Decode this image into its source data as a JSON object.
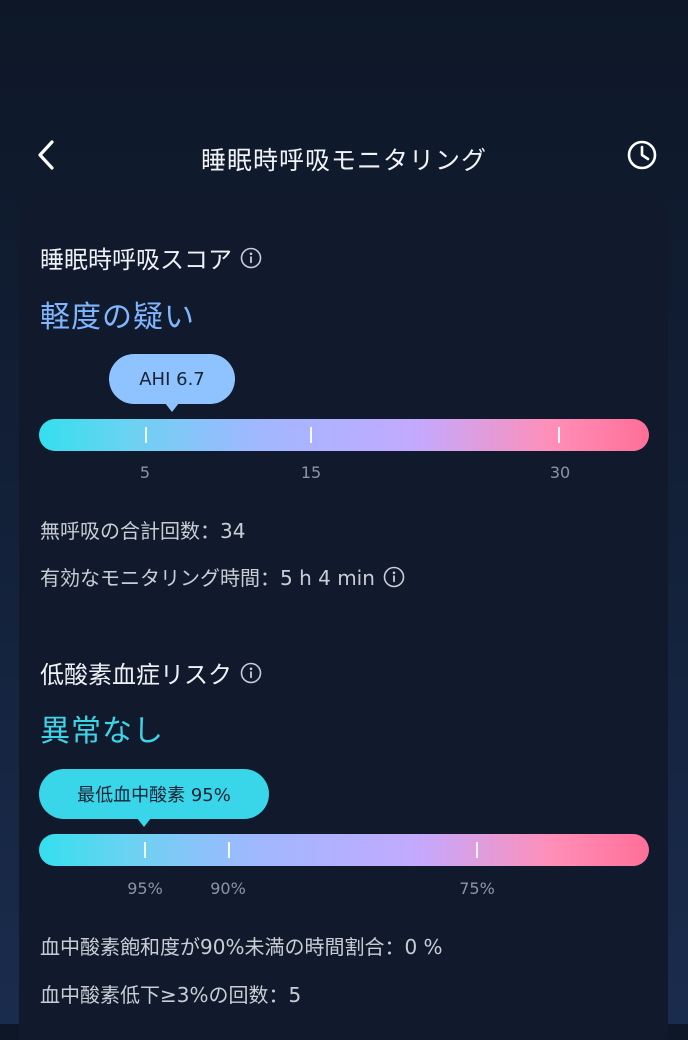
{
  "header": {
    "title": "睡眠時呼吸モニタリング"
  },
  "icons": {
    "back": "chevron-left-icon",
    "history": "clock-icon",
    "info": "info-circle-icon"
  },
  "sleep_apnea": {
    "title": "睡眠時呼吸スコア",
    "status": "軽度の疑い",
    "bubble": "AHI 6.7",
    "ahi_value": 6.7,
    "ticks": [
      "5",
      "15",
      "30"
    ],
    "total_apnea": "無呼吸の合計回数：34",
    "monitoring_time": "有効なモニタリング時間：5 h 4 min"
  },
  "hypoxemia": {
    "title": "低酸素血症リスク",
    "status": "異常なし",
    "bubble": "最低血中酸素 95%",
    "min_spo2": 95,
    "ticks": [
      "95%",
      "90%",
      "75%"
    ],
    "below_90_ratio": "血中酸素飽和度が90%未満の時間割合：0 %",
    "drop_count": "血中酸素低下≥3%の回数：5"
  },
  "colors": {
    "mild": "#7fb6ff",
    "normal": "#3fd3e6",
    "gradient_start": "#34dfee",
    "gradient_end": "#ff6f98"
  }
}
